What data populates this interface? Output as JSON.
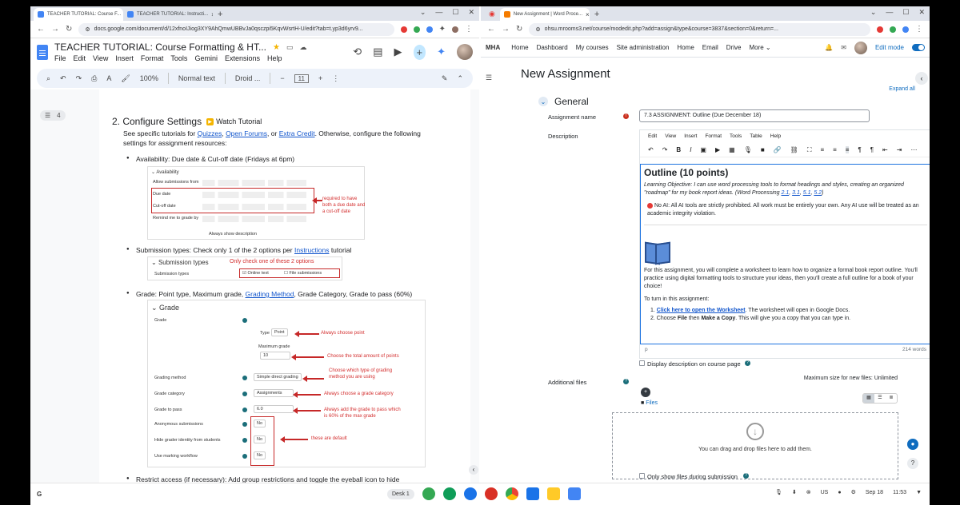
{
  "left_browser": {
    "tabs": [
      {
        "title": "TEACHER TUTORIAL: Course F...",
        "active": true
      },
      {
        "title": "TEACHER TUTORIAL: Instructi...",
        "active": false
      }
    ],
    "url": "docs.google.com/document/d/12xfnoIJiog3XY9AhQmwUBBvJa0qsczpi5KqvWsrtH-U/edit?tab=t.yp3d6yrv9..."
  },
  "doc": {
    "title": "TEACHER TUTORIAL: Course Formatting & HT...",
    "menu": [
      "File",
      "Edit",
      "View",
      "Insert",
      "Format",
      "Tools",
      "Gemini",
      "Extensions",
      "Help"
    ],
    "toolbar": {
      "zoom": "100%",
      "style": "Normal text",
      "font": "Droid ...",
      "size": "11"
    },
    "outline_count": "4",
    "heading": "2.  Configure Settings",
    "watch": "Watch Tutorial",
    "para_a": "See specific tutorials for ",
    "link_quizzes": "Quizzes",
    "link_forums": "Open Forums",
    "para_or": ", or ",
    "link_extra": "Extra Credit",
    "para_b": ". Otherwise, configure the following settings for assignment resources:",
    "bullet1": "Availability: Due date & Cut-off date (Fridays at 6pm)",
    "avail": {
      "header": "Availability",
      "rows": [
        "Allow submissions from",
        "Due date",
        "Cut-off date",
        "Remind me to grade by"
      ],
      "show_desc": "Always show description",
      "note": "required to have both a due date and a cut-off date"
    },
    "bullet2_a": "Submission types: Check only 1 of the 2 options per ",
    "bullet2_link": "Instructions",
    "bullet2_b": " tutorial",
    "sub": {
      "header": "Submission types",
      "label": "Submission types",
      "opt1": "Online text",
      "opt2": "File submissions",
      "note": "Only check one of these 2 options"
    },
    "bullet3_a": "Grade: Point type, Maximum grade, ",
    "bullet3_link": "Grading Method",
    "bullet3_b": ", Grade Category, Grade to pass (60%)",
    "grade": {
      "header": "Grade",
      "grade_label": "Grade",
      "type_label": "Type",
      "type_val": "Point",
      "max_label": "Maximum grade",
      "max_val": "10",
      "method_label": "Grading method",
      "method_val": "Simple direct grading",
      "category_label": "Grade category",
      "category_val": "Assignments",
      "pass_label": "Grade to pass",
      "pass_val": "6.0",
      "anon_label": "Anonymous submissions",
      "hide_label": "Hide grader identity from students",
      "mark_label": "Use marking workflow",
      "no": "No",
      "note_point": "Always choose point",
      "note_max": "Choose the total amount of points",
      "note_method": "Choose which type of grading method you are using",
      "note_category": "Always choose a grade category",
      "note_pass": "Always add the grade to pass which is 60% of the max grade",
      "note_default": "these are default"
    },
    "bullet4": "Restrict access (if necessary): Add group restrictions and toggle the eyeball icon to hide"
  },
  "right_browser": {
    "tabs": [
      {
        "title": "New Assignment | Word Proce...",
        "active": true
      }
    ],
    "url": "ohsu.mrooms3.net/course/modedit.php?add=assign&type&course=3837&section=0&return=..."
  },
  "moodle": {
    "brand": "MHA",
    "nav": [
      "Home",
      "Dashboard",
      "My courses",
      "Site administration",
      "Home",
      "Email",
      "Drive",
      "More"
    ],
    "edit_mode": "Edit mode",
    "page_title": "New Assignment",
    "expand_all": "Expand all",
    "section": "General",
    "name_label": "Assignment name",
    "name_value": "7.3 ASSIGNMENT: Outline (Due December 18)",
    "desc_label": "Description",
    "editor_menu": [
      "Edit",
      "View",
      "Insert",
      "Format",
      "Tools",
      "Table",
      "Help"
    ],
    "content": {
      "heading": "Outline (10 points)",
      "objective_a": "Learning Objective: I can use word processing tools to format headings and styles, creating an organized \"roadmap\" for my book report ideas. (Word Processing ",
      "obj_links": [
        "2.1",
        "3.1",
        "5.1",
        "5.2"
      ],
      "objective_b": ")",
      "no_ai": "No AI: All AI tools are strictly prohibited. All work must be entirely your own. Any AI use will be treated as an academic integrity violation.",
      "intro": "For this assignment, you will complete a worksheet to learn how to organize a formal book report outline. You'll practice using digital formatting tools to structure your ideas, then you'll create a full outline for a book of your choice!",
      "turn_in": "To turn in this assignment:",
      "step1_link": "Click here to open the Worksheet",
      "step1_b": ". The worksheet will open in Google Docs.",
      "step2_a": "Choose ",
      "step2_file": "File",
      "step2_b": " then ",
      "step2_copy": "Make a Copy",
      "step2_c": ". This will give you a copy that you can type in."
    },
    "path": "p",
    "word_count": "214 words",
    "display_desc": "Display description on course page",
    "files_label": "Additional files",
    "max_size": "Maximum size for new files: Unlimited",
    "files_folder": "Files",
    "drop_text": "You can drag and drop files here to add them.",
    "only_show": "Only show files during submission"
  },
  "taskbar": {
    "desk": "Desk 1",
    "lang": "US",
    "date": "Sep 18",
    "time": "11:53"
  },
  "colors": {
    "moodle_blue": "#0f6cbf",
    "red": "#c62828",
    "docs_blue": "#4285f4"
  }
}
